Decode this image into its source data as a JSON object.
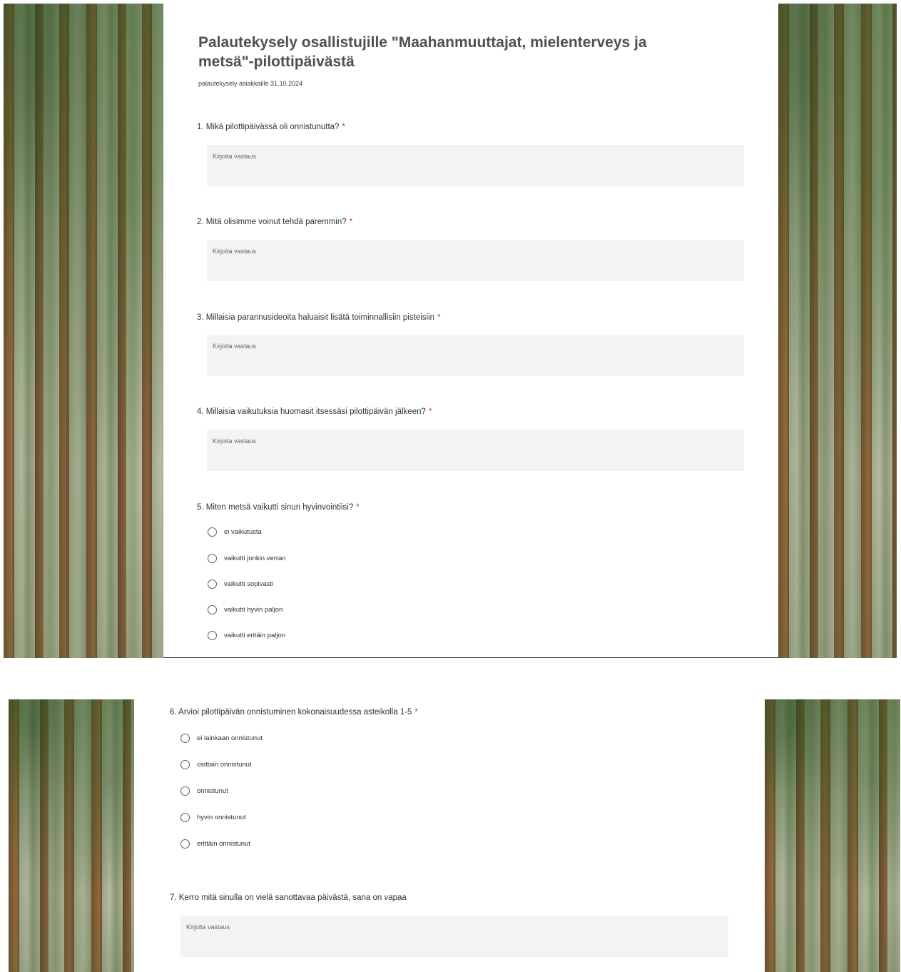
{
  "form": {
    "title": "Palautekysely osallistujille \"Maahanmuuttajat, mielenterveys ja metsä\"-pilottipäivästä",
    "subtitle": "palautekysely asiakkaille 31.10.2024",
    "required_marker": "*",
    "answer_placeholder": "Kirjoita vastaus"
  },
  "questions": [
    {
      "label": "1. Mikä pilottipäivässä oli onnistunutta?",
      "required": true
    },
    {
      "label": "2. Mitä olisimme voinut tehdä paremmin?",
      "required": true
    },
    {
      "label": "3. Millaisia parannusideoita haluaisit lisätä toiminnallisiin pisteisiin",
      "required": true
    },
    {
      "label": "4. Millaisia vaikutuksia huomasit itsessäsi pilottipäivän jälkeen?",
      "required": true
    },
    {
      "label": "5. Miten metsä vaikutti sinun hyvinvointiisi?",
      "required": true,
      "options": [
        "ei vaikutusta",
        "vaikutti jonkin verran",
        "vaikutti sopivasti",
        "vaikutti hyvin paljon",
        "vaikutti eritäin paljon"
      ]
    },
    {
      "label": "6. Arvioi pilottipäivän onnistuminen kokonaisuudessa asteikolla 1-5",
      "required": true,
      "options": [
        "ei lainkaan onnistunut",
        "osittain onnistunut",
        "onnistunut",
        "hyvin onnistunut",
        "erittäin onnistunut"
      ]
    },
    {
      "label": "7. Kerro mitä sinulla on vielä sanottavaa päivästä, sana on vapaa",
      "required": false
    }
  ]
}
